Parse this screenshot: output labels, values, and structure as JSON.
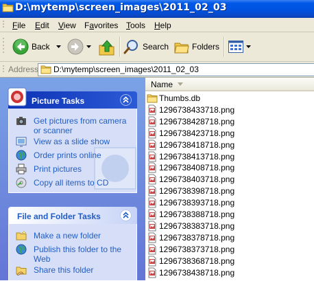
{
  "window": {
    "title": "D:\\mytemp\\screen_images\\2011_02_03"
  },
  "menu": {
    "file": {
      "key": "F",
      "rest": "ile"
    },
    "edit": {
      "key": "E",
      "rest": "dit"
    },
    "view": {
      "key": "V",
      "rest": "iew"
    },
    "favorites": {
      "pre": "F",
      "key": "a",
      "rest": "vorites"
    },
    "tools": {
      "key": "T",
      "rest": "ools"
    },
    "help": {
      "key": "H",
      "rest": "elp"
    }
  },
  "toolbar": {
    "back_label": "Back",
    "search_label": "Search",
    "folders_label": "Folders"
  },
  "address": {
    "label": "Address",
    "value": "D:\\mytemp\\screen_images\\2011_02_03"
  },
  "picture_tasks": {
    "title": "Picture Tasks",
    "items": [
      {
        "label": "Get pictures from camera",
        "label2": "or scanner",
        "icon": "camera-icon"
      },
      {
        "label": "View as a slide show",
        "icon": "slideshow-icon"
      },
      {
        "label": "Order prints online",
        "icon": "globe-icon"
      },
      {
        "label": "Print pictures",
        "icon": "printer-icon"
      },
      {
        "label": "Copy all items to CD",
        "icon": "cd-icon"
      }
    ]
  },
  "folder_tasks": {
    "title": "File and Folder Tasks",
    "items": [
      {
        "label": "Make a new folder",
        "icon": "new-folder-icon"
      },
      {
        "label": "Publish this folder to the",
        "label2": "Web",
        "icon": "globe-icon"
      },
      {
        "label": "Share this folder",
        "icon": "share-folder-icon"
      }
    ]
  },
  "file_list": {
    "column": "Name",
    "files": [
      {
        "name": "Thumbs.db",
        "type": "folder"
      },
      {
        "name": "1296738433718.png",
        "type": "png"
      },
      {
        "name": "1296738428718.png",
        "type": "png"
      },
      {
        "name": "1296738423718.png",
        "type": "png"
      },
      {
        "name": "1296738418718.png",
        "type": "png"
      },
      {
        "name": "1296738413718.png",
        "type": "png"
      },
      {
        "name": "1296738408718.png",
        "type": "png"
      },
      {
        "name": "1296738403718.png",
        "type": "png"
      },
      {
        "name": "1296738398718.png",
        "type": "png"
      },
      {
        "name": "1296738393718.png",
        "type": "png"
      },
      {
        "name": "1296738388718.png",
        "type": "png"
      },
      {
        "name": "1296738383718.png",
        "type": "png"
      },
      {
        "name": "1296738378718.png",
        "type": "png"
      },
      {
        "name": "1296738373718.png",
        "type": "png"
      },
      {
        "name": "1296738368718.png",
        "type": "png"
      },
      {
        "name": "1296738438718.png",
        "type": "png"
      }
    ]
  }
}
